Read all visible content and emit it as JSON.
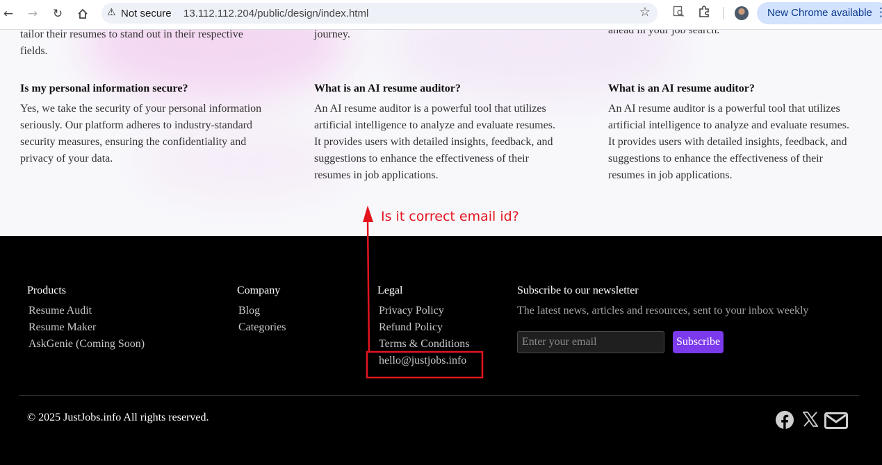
{
  "browser": {
    "not_secure_label": "Not secure",
    "url": "13.112.112.204/public/design/index.html",
    "update_label": "New Chrome available"
  },
  "faq": {
    "top_fragments": [
      "tailor their resumes to stand out in their respective fields.",
      "journey.",
      "ahead in your job search."
    ],
    "items": [
      {
        "question": "Is my personal information secure?",
        "answer": "Yes, we take the security of your personal information seriously. Our platform adheres to industry-standard security measures, ensuring the confidentiality and privacy of your data."
      },
      {
        "question": "What is an AI resume auditor?",
        "answer": "An AI resume auditor is a powerful tool that utilizes artificial intelligence to analyze and evaluate resumes. It provides users with detailed insights, feedback, and suggestions to enhance the effectiveness of their resumes in job applications."
      },
      {
        "question": "What is an AI resume auditor?",
        "answer": "An AI resume auditor is a powerful tool that utilizes artificial intelligence to analyze and evaluate resumes. It provides users with detailed insights, feedback, and suggestions to enhance the effectiveness of their resumes in job applications."
      }
    ]
  },
  "annotation": {
    "text": "Is it correct email id?",
    "color": "#e3141e"
  },
  "footer": {
    "products": {
      "heading": "Products",
      "links": [
        "Resume Audit",
        "Resume Maker",
        "AskGenie (Coming Soon)"
      ]
    },
    "company": {
      "heading": "Company",
      "links": [
        "Blog",
        "Categories"
      ]
    },
    "legal": {
      "heading": "Legal",
      "links": [
        "Privacy Policy",
        "Refund Policy",
        "Terms & Conditions",
        "hello@justjobs.info"
      ]
    },
    "newsletter": {
      "heading": "Subscribe to our newsletter",
      "description": "The latest news, articles and resources, sent to your inbox weekly",
      "email_placeholder": "Enter your email",
      "email_value": "",
      "button_label": "Subscribe",
      "button_color": "#7c3aed"
    },
    "copyright": "© 2025 JustJobs.info All rights reserved.",
    "social_icons": [
      "facebook-icon",
      "x-icon",
      "mail-icon"
    ]
  }
}
